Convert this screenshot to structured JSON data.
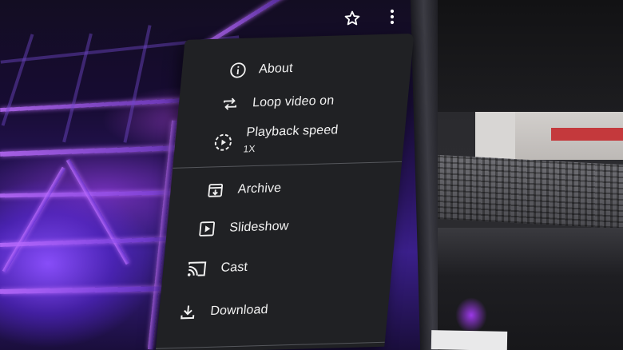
{
  "top_bar": {
    "star_icon": "star-outline-icon",
    "more_icon": "more-vert-icon"
  },
  "menu": {
    "section1": [
      {
        "label": "About",
        "icon": "info-icon"
      },
      {
        "label": "Loop video on",
        "icon": "loop-icon"
      },
      {
        "label": "Playback speed",
        "sublabel": "1X",
        "icon": "playback-speed-icon"
      }
    ],
    "section2": [
      {
        "label": "Archive",
        "icon": "archive-icon"
      },
      {
        "label": "Slideshow",
        "icon": "slideshow-icon"
      },
      {
        "label": "Cast",
        "icon": "cast-icon"
      },
      {
        "label": "Download",
        "icon": "download-icon"
      }
    ]
  },
  "colors": {
    "menu_background": "#202124",
    "menu_text": "#f1f1f1",
    "divider": "#55575c",
    "stage_light": "#8c50ff"
  }
}
